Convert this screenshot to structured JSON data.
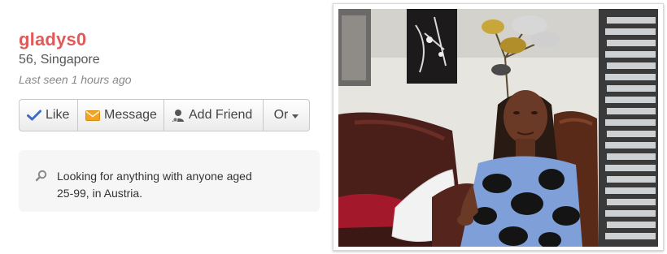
{
  "profile": {
    "username": "gladys0",
    "age_location": "56, Singapore",
    "last_seen": "Last seen 1 hours ago"
  },
  "actions": {
    "like_label": "Like",
    "message_label": "Message",
    "add_friend_label": "Add Friend",
    "or_label": "Or"
  },
  "looking_for": {
    "text": "Looking for anything with anyone aged 25-99, in Austria."
  },
  "icons": {
    "like": "check-icon",
    "message": "envelope-icon",
    "add_friend": "person-icon",
    "looking": "search-icon"
  },
  "colors": {
    "username": "#e05a5a",
    "check": "#3d6cc4",
    "envelope": "#f2a321"
  }
}
